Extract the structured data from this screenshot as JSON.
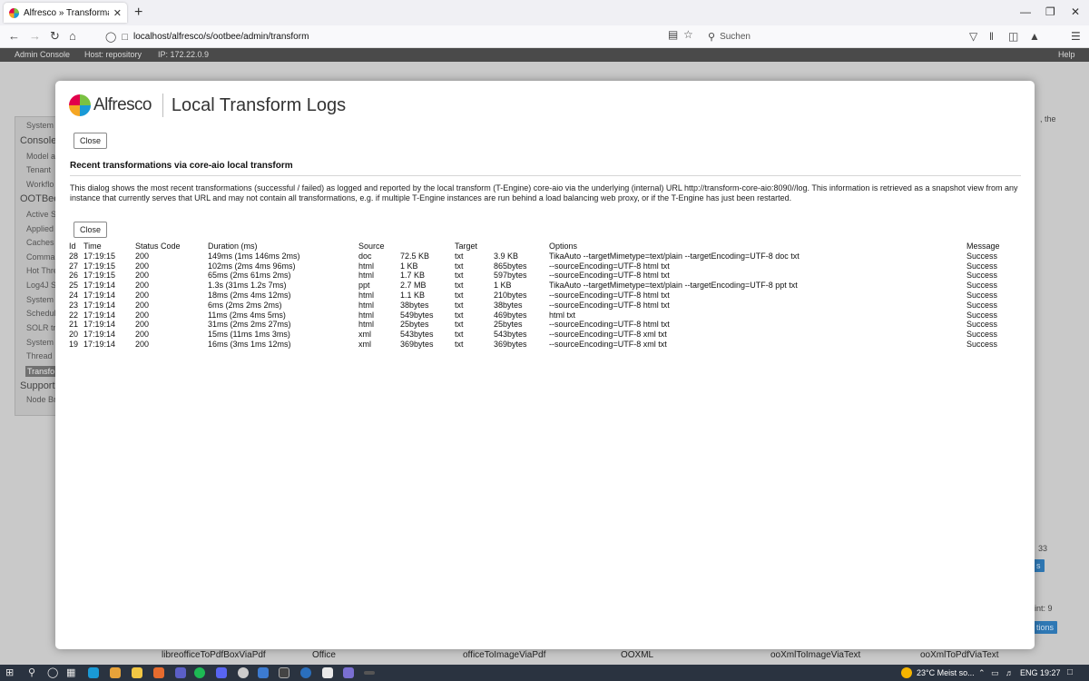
{
  "browser": {
    "tab_title": "Alfresco » Transformations [Ho",
    "tab_close": "✕",
    "new_tab": "+",
    "url": "localhost/alfresco/s/ootbee/admin/transform",
    "search_placeholder": "Suchen"
  },
  "admin_header": {
    "title": "Admin Console",
    "host": "Host: repository",
    "ip": "IP: 172.22.0.9",
    "help": "Help"
  },
  "background": {
    "sidebar": [
      {
        "label": "System",
        "kind": "item"
      },
      {
        "label": "Console",
        "kind": "section"
      },
      {
        "label": "Model a",
        "kind": "item"
      },
      {
        "label": "Tenant",
        "kind": "item"
      },
      {
        "label": "Workflo",
        "kind": "item"
      },
      {
        "label": "OOTBee",
        "kind": "section"
      },
      {
        "label": "Active Se",
        "kind": "item"
      },
      {
        "label": "Applied",
        "kind": "item"
      },
      {
        "label": "Caches",
        "kind": "item"
      },
      {
        "label": "Comma",
        "kind": "item"
      },
      {
        "label": "Hot Thre",
        "kind": "item"
      },
      {
        "label": "Log4J Se",
        "kind": "item"
      },
      {
        "label": "System",
        "kind": "item"
      },
      {
        "label": "Schedul",
        "kind": "item"
      },
      {
        "label": "SOLR tra",
        "kind": "item"
      },
      {
        "label": "System",
        "kind": "item"
      },
      {
        "label": "Thread",
        "kind": "item"
      },
      {
        "label": "Transfo",
        "kind": "active"
      },
      {
        "label": "Support",
        "kind": "section"
      },
      {
        "label": "Node Br",
        "kind": "item"
      }
    ],
    "right_text": ", the",
    "right_count": "33",
    "right_btn1": "s",
    "right_count_label": "int: 9",
    "right_btn2": "tions",
    "bottom_labels": [
      "libreofficeToPdfBoxViaPdf",
      "Office",
      "officeToImageViaPdf",
      "OOXML",
      "ooXmlToImageViaText",
      "ooXmlToPdfViaText"
    ]
  },
  "dialog": {
    "logo_text": "Alfresco",
    "title": "Local Transform Logs",
    "close_label": "Close",
    "section_title": "Recent transformations via core-aio local transform",
    "description": "This dialog shows the most recent transformations (successful / failed) as logged and reported by the local transform (T-Engine) core-aio via the underlying (internal) URL http://transform-core-aio:8090//log. This information is retrieved as a snapshot view from any instance that currently serves that URL and may not contain all transformations, e.g. if multiple T-Engine instances are run behind a load balancing web proxy, or if the T-Engine has just been restarted.",
    "table": {
      "headers": [
        "Id",
        "Time",
        "Status Code",
        "Duration (ms)",
        "Source",
        "",
        "Target",
        "",
        "Options",
        "Message"
      ],
      "rows": [
        [
          "28",
          "17:19:15",
          "200",
          "149ms (1ms 146ms 2ms)",
          "doc",
          "72.5 KB",
          "txt",
          "3.9 KB",
          "TikaAuto --targetMimetype=text/plain --targetEncoding=UTF-8 doc txt",
          "Success"
        ],
        [
          "27",
          "17:19:15",
          "200",
          "102ms (2ms 4ms 96ms)",
          "html",
          "1 KB",
          "txt",
          "865bytes",
          "--sourceEncoding=UTF-8 html txt",
          "Success"
        ],
        [
          "26",
          "17:19:15",
          "200",
          "65ms (2ms 61ms 2ms)",
          "html",
          "1.7 KB",
          "txt",
          "597bytes",
          "--sourceEncoding=UTF-8 html txt",
          "Success"
        ],
        [
          "25",
          "17:19:14",
          "200",
          "1.3s (31ms 1.2s 7ms)",
          "ppt",
          "2.7 MB",
          "txt",
          "1 KB",
          "TikaAuto --targetMimetype=text/plain --targetEncoding=UTF-8 ppt txt",
          "Success"
        ],
        [
          "24",
          "17:19:14",
          "200",
          "18ms (2ms 4ms 12ms)",
          "html",
          "1.1 KB",
          "txt",
          "210bytes",
          "--sourceEncoding=UTF-8 html txt",
          "Success"
        ],
        [
          "23",
          "17:19:14",
          "200",
          "6ms (2ms 2ms 2ms)",
          "html",
          "38bytes",
          "txt",
          "38bytes",
          "--sourceEncoding=UTF-8 html txt",
          "Success"
        ],
        [
          "22",
          "17:19:14",
          "200",
          "11ms (2ms 4ms 5ms)",
          "html",
          "549bytes",
          "txt",
          "469bytes",
          "html txt",
          "Success"
        ],
        [
          "21",
          "17:19:14",
          "200",
          "31ms (2ms 2ms 27ms)",
          "html",
          "25bytes",
          "txt",
          "25bytes",
          "--sourceEncoding=UTF-8 html txt",
          "Success"
        ],
        [
          "20",
          "17:19:14",
          "200",
          "15ms (11ms 1ms 3ms)",
          "xml",
          "543bytes",
          "txt",
          "543bytes",
          "--sourceEncoding=UTF-8 xml txt",
          "Success"
        ],
        [
          "19",
          "17:19:14",
          "200",
          "16ms (3ms 1ms 12ms)",
          "xml",
          "369bytes",
          "txt",
          "369bytes",
          "--sourceEncoding=UTF-8 xml txt",
          "Success"
        ]
      ]
    }
  },
  "taskbar": {
    "weather": "23°C  Meist so...",
    "language": "ENG",
    "time": "19:27"
  },
  "colors": {
    "admin_bar": "#4a4a4a",
    "taskbar": "#2a3340",
    "accent_blue": "#2f78b4",
    "logo_green": "#7bc142",
    "logo_blue": "#1a9ad6",
    "logo_orange": "#f5a623",
    "logo_red": "#e2004b"
  }
}
